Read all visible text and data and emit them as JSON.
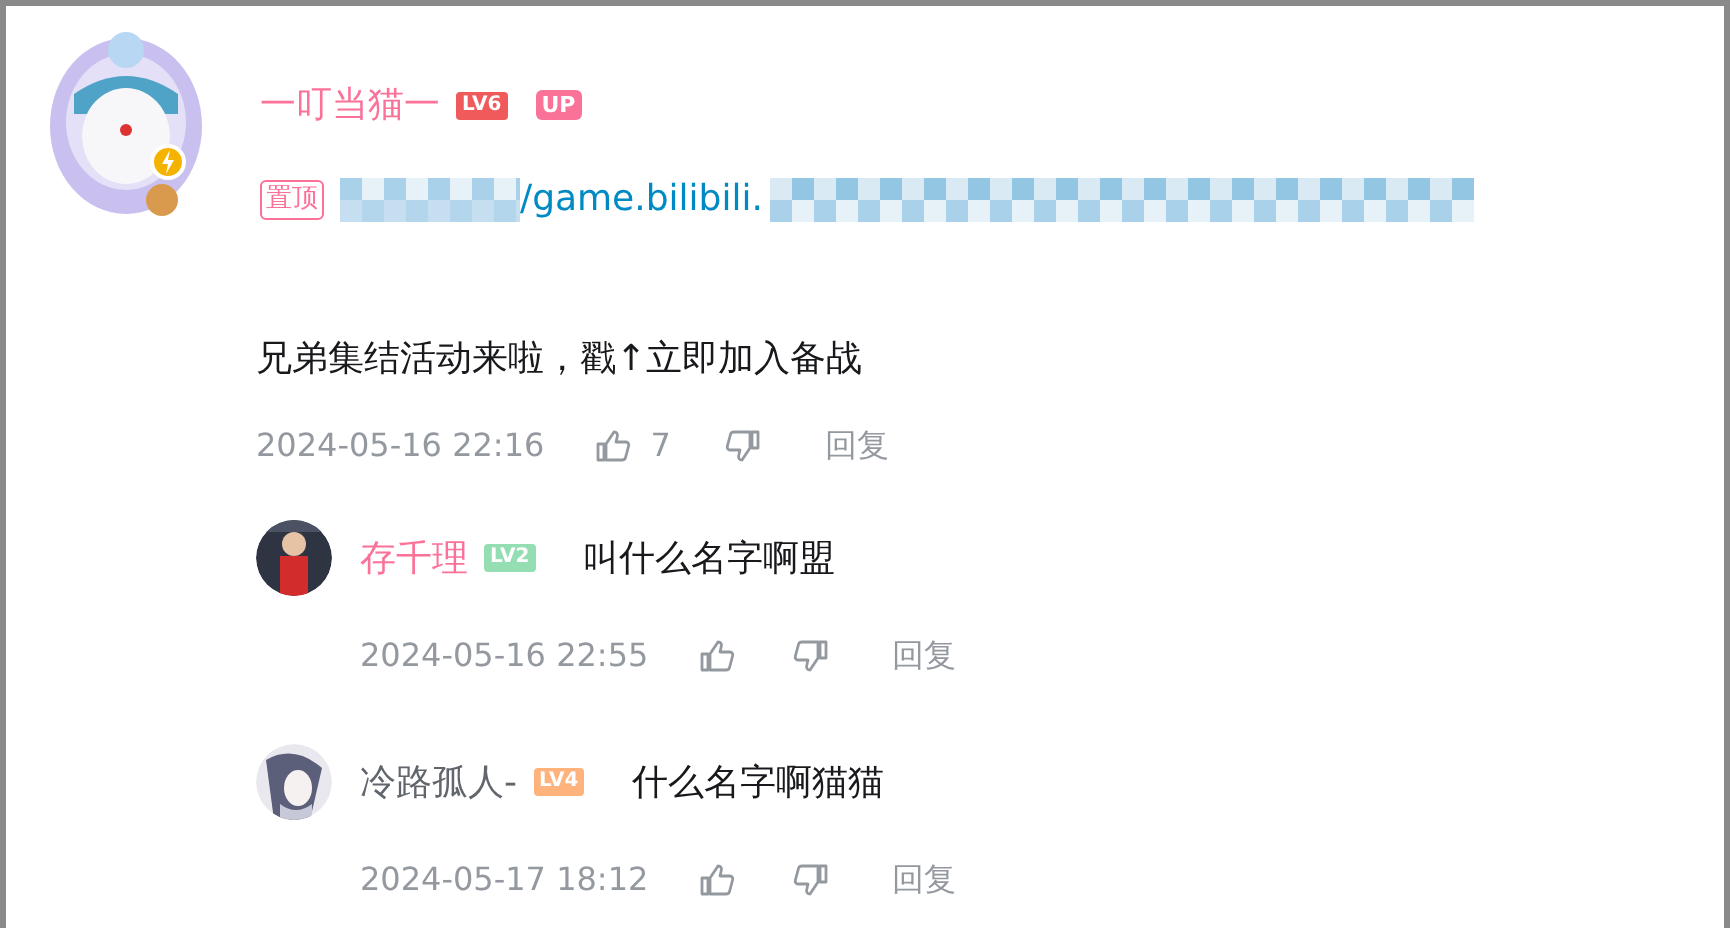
{
  "comment": {
    "user": {
      "name": "一叮当猫一",
      "vip": true,
      "level": {
        "text": "LV6",
        "color": "#f15a5a"
      },
      "up_badge": "UP"
    },
    "pinned_tag": "置顶",
    "link_text": "/game.bilibili.",
    "content": "兄弟集结活动来啦，戳↑立即加入备战",
    "time": "2024-05-16 22:16",
    "likes": "7",
    "reply_label": "回复",
    "replies": [
      {
        "user": {
          "name": "存千理",
          "vip": true,
          "level": {
            "text": "LV2",
            "color": "#95ddb2"
          }
        },
        "content": "叫什么名字啊盟",
        "time": "2024-05-16 22:55",
        "reply_label": "回复"
      },
      {
        "user": {
          "name": "冷路孤人-",
          "vip": false,
          "level": {
            "text": "LV4",
            "color": "#ffb37c"
          }
        },
        "content": "什么名字啊猫猫",
        "time": "2024-05-17 18:12",
        "reply_label": "回复"
      }
    ]
  }
}
